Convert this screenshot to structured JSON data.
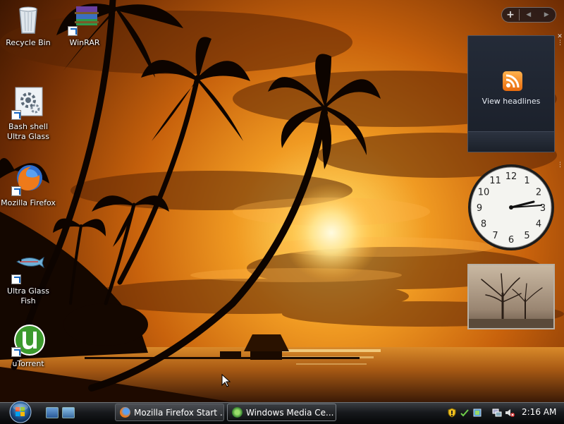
{
  "desktop": {
    "icons": [
      {
        "name": "Recycle Bin",
        "label": "Recycle Bin",
        "shortcut": false,
        "icon": "recycle-bin-icon"
      },
      {
        "name": "WinRAR",
        "label": "WinRAR",
        "shortcut": true,
        "icon": "winrar-icon"
      },
      {
        "name": "Bash shell Ultra Glass",
        "label": "Bash shell\nUltra Glass",
        "shortcut": true,
        "icon": "settings-gear-icon"
      },
      {
        "name": "Mozilla Firefox",
        "label": "Mozilla Firefox",
        "shortcut": true,
        "icon": "firefox-icon"
      },
      {
        "name": "Ultra Glass Fish",
        "label": "Ultra Glass\nFish",
        "shortcut": true,
        "icon": "fish-icon"
      },
      {
        "name": "uTorrent",
        "label": "uTorrent",
        "shortcut": true,
        "icon": "utorrent-icon"
      }
    ]
  },
  "sidebar": {
    "add_label": "+",
    "prev_label": "◀",
    "next_label": "▶",
    "feed_gadget": {
      "label": "View headlines",
      "icon": "rss-icon"
    },
    "clock_gadget": {
      "numerals": [
        "12",
        "1",
        "2",
        "3",
        "4",
        "5",
        "6",
        "7",
        "8",
        "9",
        "10",
        "11"
      ],
      "time_shown": "2:16"
    },
    "slideshow_gadget": {
      "icon": "tree-photo"
    }
  },
  "taskbar": {
    "start_icon": "windows-start-orb",
    "quick_launch": [
      "show-desktop-icon",
      "switch-windows-icon"
    ],
    "buttons": [
      {
        "label": "Mozilla Firefox Start ...",
        "icon": "firefox-icon",
        "active": false
      },
      {
        "label": "Windows Media Ce...",
        "icon": "media-center-icon",
        "active": true
      }
    ],
    "tray_icons": [
      "security-shield-icon",
      "sync-icon",
      "network-icon",
      "network-connections-icon",
      "volume-muted-icon"
    ],
    "clock": "2:16 AM"
  },
  "colors": {
    "sky_top": "#e88a1e",
    "sky_bottom": "#7a3506",
    "taskbar": "#17191c",
    "rss": "#f28c1e"
  }
}
